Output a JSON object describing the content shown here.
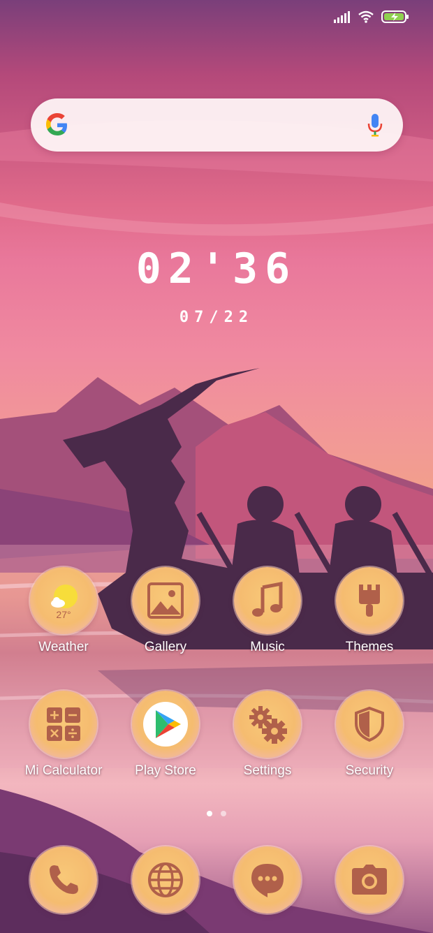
{
  "status_bar": {
    "icons": [
      "signal-icon",
      "wifi-icon",
      "battery-charging-icon"
    ]
  },
  "search": {
    "icons": [
      "google-logo-icon",
      "mic-icon"
    ]
  },
  "clock": {
    "time": "02'36",
    "date": "07/22"
  },
  "apps_row1": [
    {
      "label": "Weather",
      "icon": "weather-icon",
      "temp": "27°"
    },
    {
      "label": "Gallery",
      "icon": "gallery-icon"
    },
    {
      "label": "Music",
      "icon": "music-icon"
    },
    {
      "label": "Themes",
      "icon": "themes-icon"
    }
  ],
  "apps_row2": [
    {
      "label": "Mi Calculator",
      "icon": "calculator-icon"
    },
    {
      "label": "Play Store",
      "icon": "play-store-icon"
    },
    {
      "label": "Settings",
      "icon": "settings-icon"
    },
    {
      "label": "Security",
      "icon": "security-icon"
    }
  ],
  "dock": [
    {
      "icon": "phone-icon"
    },
    {
      "icon": "browser-icon"
    },
    {
      "icon": "messages-icon"
    },
    {
      "icon": "camera-icon"
    }
  ],
  "page_indicator": {
    "pages": 2,
    "current": 1
  },
  "colors": {
    "icon_bg": "#f5bc70",
    "icon_glyph": "#b0604a",
    "wallpaper_accent": "#e9789b"
  }
}
